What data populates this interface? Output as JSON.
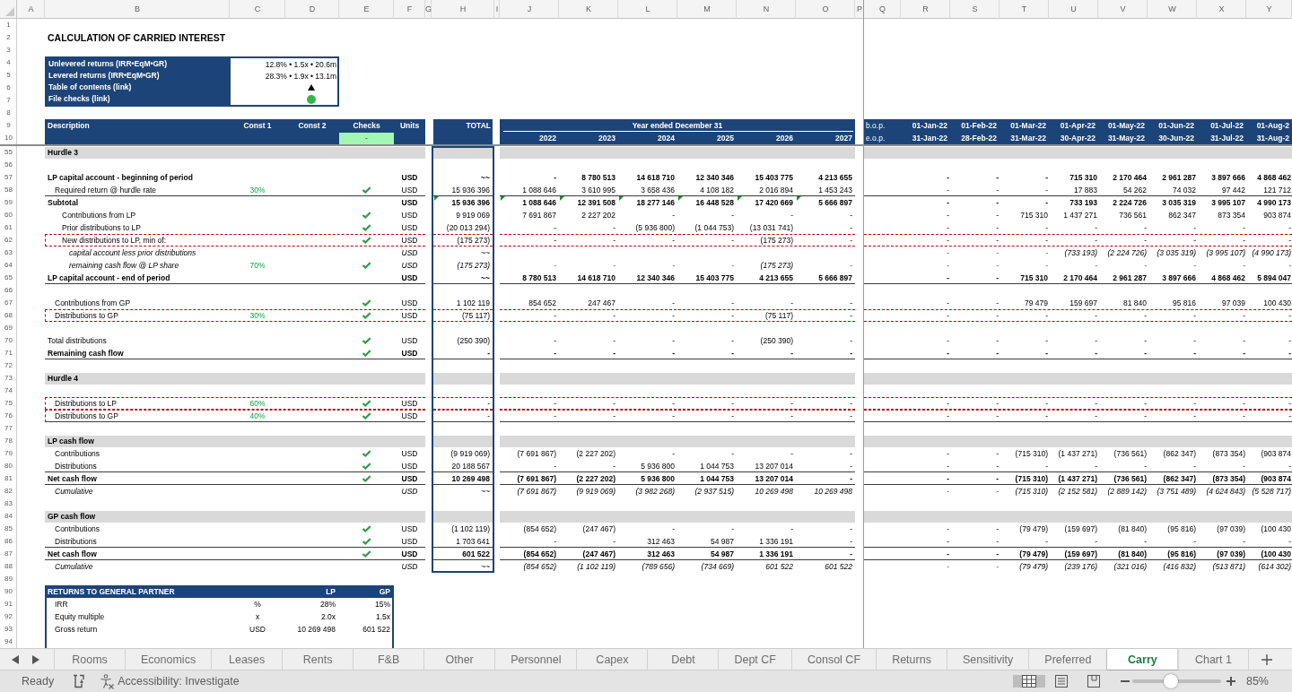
{
  "column_letters": [
    "A",
    "B",
    "C",
    "D",
    "E",
    "F",
    "G",
    "H",
    "I",
    "J",
    "K",
    "L",
    "M",
    "N",
    "O",
    "P",
    "Q",
    "R",
    "S",
    "T",
    "U",
    "V",
    "W",
    "X",
    "Y"
  ],
  "row_numbers": [
    "1",
    "2",
    "3",
    "4",
    "5",
    "6",
    "7",
    "8",
    "9",
    "10",
    "55",
    "56",
    "57",
    "58",
    "59",
    "60",
    "61",
    "62",
    "63",
    "64",
    "65",
    "66",
    "67",
    "68",
    "69",
    "70",
    "71",
    "72",
    "73",
    "74",
    "75",
    "76",
    "77",
    "78",
    "79",
    "80",
    "81",
    "82",
    "83",
    "84",
    "85",
    "86",
    "87",
    "88",
    "89",
    "90",
    "91",
    "92",
    "93",
    "94"
  ],
  "title": "CALCULATION OF CARRIED INTEREST",
  "summary": [
    {
      "kind": "value",
      "label": "Unlevered returns (IRR•EqM•GR)",
      "value": "12.8% • 1.5x • 20.6m"
    },
    {
      "kind": "value",
      "label": "Levered returns (IRR•EqM•GR)",
      "value": "28.3% • 1.9x • 13.1m"
    },
    {
      "kind": "link",
      "label": "Table of contents (link)"
    },
    {
      "kind": "status",
      "label": "File checks (link)",
      "color": "#33b549"
    }
  ],
  "header": {
    "description": "Description",
    "const_1": "Const 1",
    "const_2": "Const 2",
    "checks": "Checks",
    "checks_status": {
      "text": "-",
      "ok": true
    },
    "units": "Units",
    "total": "TOTAL",
    "period": "Year ended December 31",
    "years": [
      "2022",
      "2023",
      "2024",
      "2025",
      "2026",
      "2027"
    ],
    "period_start": "b.o.p.",
    "period_end": "e.o.p.",
    "months": [
      {
        "start": "01-Jan-22",
        "end": "31-Jan-22"
      },
      {
        "start": "01-Feb-22",
        "end": "28-Feb-22"
      },
      {
        "start": "01-Mar-22",
        "end": "31-Mar-22"
      },
      {
        "start": "01-Apr-22",
        "end": "30-Apr-22"
      },
      {
        "start": "01-May-22",
        "end": "31-May-22"
      },
      {
        "start": "01-Jun-22",
        "end": "30-Jun-22"
      },
      {
        "start": "01-Jul-22",
        "end": "31-Jul-22"
      },
      {
        "start": "01-Aug-2",
        "end": "31-Aug-2"
      }
    ]
  },
  "rows": [
    {
      "kind": "section",
      "label": "Hurdle 3"
    },
    {
      "kind": "blank"
    },
    {
      "kind": "total",
      "label": "LP capital account - beginning of period",
      "checked": false,
      "unit": "USD",
      "total": "~~",
      "values": [
        "-",
        "8 780 513",
        "14 618 710",
        "12 340 346",
        "15 403 775",
        "4 213 655"
      ],
      "monthly": [
        "-",
        "-",
        "-",
        "715 310",
        "2 170 464",
        "2 961 287",
        "3 897 666",
        "4 868 462"
      ],
      "rule_below": false,
      "outlined": false,
      "error_flag": false
    },
    {
      "kind": "item",
      "label": "Required return @ hurdle rate",
      "constant": "30%",
      "checked": true,
      "unit": "USD",
      "total": "15 936 396",
      "values": [
        "1 088 646",
        "3 610 995",
        "3 658 436",
        "4 108 182",
        "2 016 894",
        "1 453 243"
      ],
      "monthly": [
        "-",
        "-",
        "-",
        "17 883",
        "54 262",
        "74 032",
        "97 442",
        "121 712"
      ],
      "rule_below": true,
      "outlined": false,
      "error_flag": false
    },
    {
      "kind": "total",
      "label": "Subtotal",
      "checked": false,
      "unit": "USD",
      "total": "15 936 396",
      "values": [
        "1 088 646",
        "12 391 508",
        "18 277 146",
        "16 448 528",
        "17 420 669",
        "5 666 897"
      ],
      "monthly": [
        "-",
        "-",
        "-",
        "733 193",
        "2 224 726",
        "3 035 319",
        "3 995 107",
        "4 990 173"
      ],
      "rule_below": false,
      "outlined": false,
      "error_flag": true
    },
    {
      "kind": "subitem",
      "label": "Contributions from LP",
      "checked": true,
      "unit": "USD",
      "total": "9 919 069",
      "values": [
        "7 691 867",
        "2 227 202",
        "-",
        "-",
        "-",
        "-"
      ],
      "monthly": [
        "-",
        "-",
        "715 310",
        "1 437 271",
        "736 561",
        "862 347",
        "873 354",
        "903 874"
      ],
      "rule_below": false,
      "outlined": false,
      "error_flag": false
    },
    {
      "kind": "subitem",
      "label": "Prior distributions to LP",
      "checked": true,
      "unit": "USD",
      "total": "(20 013 294)",
      "values": [
        "-",
        "-",
        "(5 936 800)",
        "(1 044 753)",
        "(13 031 741)",
        "-"
      ],
      "monthly": [
        "-",
        "-",
        "-",
        "-",
        "-",
        "-",
        "-",
        "-"
      ],
      "rule_below": false,
      "outlined": false,
      "error_flag": false
    },
    {
      "kind": "subitem",
      "label": "New distributions to LP, min of:",
      "checked": true,
      "unit": "USD",
      "total": "(175 273)",
      "values": [
        "-",
        "-",
        "-",
        "-",
        "(175 273)",
        "-"
      ],
      "monthly": [
        "-",
        "-",
        "-",
        "-",
        "-",
        "-",
        "-",
        "-"
      ],
      "rule_below": false,
      "outlined": true,
      "error_flag": false
    },
    {
      "kind": "detail",
      "label": "capital account less prior distributions",
      "checked": false,
      "unit": "USD",
      "total": "~~",
      "monthly": [
        "-",
        "-",
        "-",
        "(733 193)",
        "(2 224 726)",
        "(3 035 319)",
        "(3 995 107)",
        "(4 990 173)"
      ],
      "rule_below": false,
      "outlined": false,
      "error_flag": false
    },
    {
      "kind": "detail",
      "label": "remaining cash flow @ LP share",
      "constant": "70%",
      "checked": true,
      "unit": "USD",
      "total": "(175 273)",
      "values": [
        "-",
        "-",
        "-",
        "-",
        "(175 273)",
        "-"
      ],
      "monthly": [
        "-",
        "-",
        "-",
        "-",
        "-",
        "-",
        "-",
        "-"
      ],
      "rule_below": false,
      "outlined": false,
      "error_flag": false
    },
    {
      "kind": "total",
      "label": "LP capital account - end of period",
      "checked": false,
      "unit": "USD",
      "total": "~~",
      "values": [
        "8 780 513",
        "14 618 710",
        "12 340 346",
        "15 403 775",
        "4 213 655",
        "5 666 897"
      ],
      "monthly": [
        "-",
        "-",
        "715 310",
        "2 170 464",
        "2 961 287",
        "3 897 666",
        "4 868 462",
        "5 894 047"
      ],
      "rule_below": true,
      "outlined": false,
      "error_flag": false
    },
    {
      "kind": "blank"
    },
    {
      "kind": "item",
      "label": "Contributions from GP",
      "checked": true,
      "unit": "USD",
      "total": "1 102 119",
      "values": [
        "854 652",
        "247 467",
        "-",
        "-",
        "-",
        "-"
      ],
      "monthly": [
        "-",
        "-",
        "79 479",
        "159 697",
        "81 840",
        "95 816",
        "97 039",
        "100 430"
      ],
      "rule_below": false,
      "outlined": false,
      "error_flag": false
    },
    {
      "kind": "item",
      "label": "Distributions to GP",
      "constant": "30%",
      "checked": true,
      "unit": "USD",
      "total": "(75 117)",
      "values": [
        "-",
        "-",
        "-",
        "-",
        "(75 117)",
        "-"
      ],
      "monthly": [
        "-",
        "-",
        "-",
        "-",
        "-",
        "-",
        "-",
        "-"
      ],
      "rule_below": false,
      "outlined": true,
      "error_flag": false
    },
    {
      "kind": "blank"
    },
    {
      "kind": "plain",
      "label": "Total distributions",
      "checked": true,
      "unit": "USD",
      "total": "(250 390)",
      "values": [
        "-",
        "-",
        "-",
        "-",
        "(250 390)",
        "-"
      ],
      "monthly": [
        "-",
        "-",
        "-",
        "-",
        "-",
        "-",
        "-",
        "-"
      ],
      "rule_below": false,
      "outlined": false,
      "error_flag": false
    },
    {
      "kind": "total",
      "label": "Remaining cash flow",
      "checked": true,
      "unit": "USD",
      "total": "-",
      "values": [
        "-",
        "-",
        "-",
        "-",
        "-",
        "-"
      ],
      "monthly": [
        "-",
        "-",
        "-",
        "-",
        "-",
        "-",
        "-",
        "-"
      ],
      "rule_below": true,
      "outlined": false,
      "error_flag": false
    },
    {
      "kind": "blank"
    },
    {
      "kind": "section",
      "label": "Hurdle 4"
    },
    {
      "kind": "blank"
    },
    {
      "kind": "item",
      "label": "Distributions to LP",
      "constant": "60%",
      "checked": true,
      "unit": "USD",
      "total": "-",
      "values": [
        "-",
        "-",
        "-",
        "-",
        "-",
        "-"
      ],
      "monthly": [
        "-",
        "-",
        "-",
        "-",
        "-",
        "-",
        "-",
        "-"
      ],
      "rule_below": false,
      "outlined": true,
      "error_flag": false
    },
    {
      "kind": "item",
      "label": "Distributions to GP",
      "constant": "40%",
      "checked": true,
      "unit": "USD",
      "total": "-",
      "values": [
        "-",
        "-",
        "-",
        "-",
        "-",
        "-"
      ],
      "monthly": [
        "-",
        "-",
        "-",
        "-",
        "-",
        "-",
        "-",
        "-"
      ],
      "rule_below": true,
      "outlined": true,
      "error_flag": false
    },
    {
      "kind": "blank"
    },
    {
      "kind": "section",
      "label": "LP cash flow"
    },
    {
      "kind": "item",
      "label": "Contributions",
      "checked": true,
      "unit": "USD",
      "total": "(9 919 069)",
      "values": [
        "(7 691 867)",
        "(2 227 202)",
        "-",
        "-",
        "-",
        "-"
      ],
      "monthly": [
        "-",
        "-",
        "(715 310)",
        "(1 437 271)",
        "(736 561)",
        "(862 347)",
        "(873 354)",
        "(903 874"
      ],
      "rule_below": false,
      "outlined": false,
      "error_flag": false
    },
    {
      "kind": "item",
      "label": "Distributions",
      "checked": true,
      "unit": "USD",
      "total": "20 188 567",
      "values": [
        "-",
        "-",
        "5 936 800",
        "1 044 753",
        "13 207 014",
        "-"
      ],
      "monthly": [
        "-",
        "-",
        "-",
        "-",
        "-",
        "-",
        "-",
        "-"
      ],
      "rule_below": true,
      "outlined": false,
      "error_flag": false
    },
    {
      "kind": "total",
      "label": "Net cash flow",
      "checked": true,
      "unit": "USD",
      "total": "10 269 498",
      "values": [
        "(7 691 867)",
        "(2 227 202)",
        "5 936 800",
        "1 044 753",
        "13 207 014",
        "-"
      ],
      "monthly": [
        "-",
        "-",
        "(715 310)",
        "(1 437 271)",
        "(736 561)",
        "(862 347)",
        "(873 354)",
        "(903 874"
      ],
      "rule_below": true,
      "outlined": false,
      "error_flag": false
    },
    {
      "kind": "cumulative",
      "label": "Cumulative",
      "checked": false,
      "unit": "USD",
      "total": "~~",
      "values": [
        "(7 691 867)",
        "(9 919 069)",
        "(3 982 268)",
        "(2 937 515)",
        "10 269 498",
        "10 269 498"
      ],
      "monthly": [
        "-",
        "-",
        "(715 310)",
        "(2 152 581)",
        "(2 889 142)",
        "(3 751 489)",
        "(4 624 843)",
        "(5 528 717)"
      ],
      "rule_below": false,
      "outlined": false,
      "error_flag": false
    },
    {
      "kind": "blank"
    },
    {
      "kind": "section",
      "label": "GP cash flow"
    },
    {
      "kind": "item",
      "label": "Contributions",
      "checked": true,
      "unit": "USD",
      "total": "(1 102 119)",
      "values": [
        "(854 652)",
        "(247 467)",
        "-",
        "-",
        "-",
        "-"
      ],
      "monthly": [
        "-",
        "-",
        "(79 479)",
        "(159 697)",
        "(81 840)",
        "(95 816)",
        "(97 039)",
        "(100 430"
      ],
      "rule_below": false,
      "outlined": false,
      "error_flag": false
    },
    {
      "kind": "item",
      "label": "Distributions",
      "checked": true,
      "unit": "USD",
      "total": "1 703 641",
      "values": [
        "-",
        "-",
        "312 463",
        "54 987",
        "1 336 191",
        "-"
      ],
      "monthly": [
        "-",
        "-",
        "-",
        "-",
        "-",
        "-",
        "-",
        "-"
      ],
      "rule_below": true,
      "outlined": false,
      "error_flag": false
    },
    {
      "kind": "total",
      "label": "Net cash flow",
      "checked": true,
      "unit": "USD",
      "total": "601 522",
      "values": [
        "(854 652)",
        "(247 467)",
        "312 463",
        "54 987",
        "1 336 191",
        "-"
      ],
      "monthly": [
        "-",
        "-",
        "(79 479)",
        "(159 697)",
        "(81 840)",
        "(95 816)",
        "(97 039)",
        "(100 430"
      ],
      "rule_below": true,
      "outlined": false,
      "error_flag": false
    },
    {
      "kind": "cumulative",
      "label": "Cumulative",
      "checked": false,
      "unit": "USD",
      "total": "~~",
      "values": [
        "(854 652)",
        "(1 102 119)",
        "(789 656)",
        "(734 669)",
        "601 522",
        "601 522"
      ],
      "monthly": [
        "-",
        "-",
        "(79 479)",
        "(239 176)",
        "(321 016)",
        "(416 832)",
        "(513 871)",
        "(614 302)"
      ],
      "rule_below": false,
      "outlined": false,
      "error_flag": false
    },
    {
      "kind": "blank"
    }
  ],
  "returns": {
    "title": "RETURNS TO GENERAL PARTNER",
    "lp_heading": "LP",
    "gp_heading": "GP",
    "rows": [
      {
        "label": "IRR",
        "unit": "%",
        "lp": "28%",
        "gp": "15%"
      },
      {
        "label": "Equity multiple",
        "unit": "x",
        "lp": "2.0x",
        "gp": "1.5x"
      },
      {
        "label": "Gross return",
        "unit": "USD",
        "lp": "10 269 498",
        "gp": "601 522"
      }
    ]
  },
  "sheet_tabs": [
    {
      "label": "Rooms",
      "selected": false
    },
    {
      "label": "Economics",
      "selected": false
    },
    {
      "label": "Leases",
      "selected": false
    },
    {
      "label": "Rents",
      "selected": false
    },
    {
      "label": "F&B",
      "selected": false
    },
    {
      "label": "Other",
      "selected": false
    },
    {
      "label": "Personnel",
      "selected": false
    },
    {
      "label": "Capex",
      "selected": false
    },
    {
      "label": "Debt",
      "selected": false
    },
    {
      "label": "Dept CF",
      "selected": false
    },
    {
      "label": "Consol CF",
      "selected": false
    },
    {
      "label": "Returns",
      "selected": false
    },
    {
      "label": "Sensitivity",
      "selected": false
    },
    {
      "label": "Preferred",
      "selected": false
    },
    {
      "label": "Carry",
      "selected": true
    },
    {
      "label": "Chart 1",
      "selected": false
    }
  ],
  "status_bar": {
    "status": "Ready",
    "accessibility": "Accessibility: Investigate",
    "views": [
      {
        "kind": "normal",
        "selected": true
      },
      {
        "kind": "page-layout",
        "selected": false
      },
      {
        "kind": "page-break",
        "selected": false
      }
    ],
    "zoom": {
      "level": 0.43,
      "reading": "85%"
    }
  }
}
